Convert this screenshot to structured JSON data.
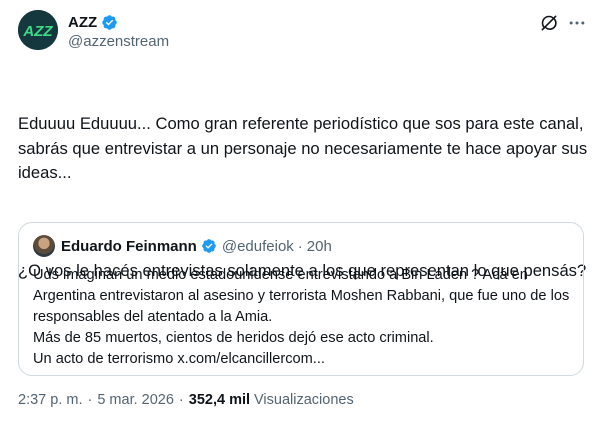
{
  "author": {
    "display_name": "AZZ",
    "handle": "@azzenstream",
    "avatar_text": "AZZ",
    "verified_icon": "verified-badge-icon"
  },
  "header_actions": {
    "grok_icon": "grok-icon",
    "more_icon": "more-options-icon"
  },
  "tweet": {
    "paragraph1": "Eduuuu Eduuuu... Como gran referente periodístico que sos para este canal, sabrás que entrevistar a un personaje no necesariamente te hace apoyar sus ideas...",
    "paragraph2": "¿O vos le hacés entrevistas solamente a los que representan lo que pensás?"
  },
  "quoted_tweet": {
    "display_name": "Eduardo Feinmann",
    "handle": "@edufeiok",
    "separator": "·",
    "time": "20h",
    "lines": [
      "Uds imaginan un medio estadounidense entrevistando a Bin Laden ?  Acá en Argentina entrevistaron al asesino y terrorista Moshen Rabbani, que fue uno de los responsables del atentado a la Amia.",
      "Más de 85 muertos, cientos de heridos dejó ese acto criminal.",
      "Un acto de terrorismo x.com/elcancillercom..."
    ]
  },
  "footer": {
    "time": "2:37 p. m.",
    "separator": "·",
    "date": "5 mar. 2026",
    "views_count": "352,4 mil",
    "views_label": "Visualizaciones"
  },
  "colors": {
    "verified_blue": "#1d9bf0",
    "secondary_text": "#536471",
    "border": "#cfd9de",
    "avatar_bg": "#15383f",
    "avatar_accent": "#3ddc84"
  }
}
